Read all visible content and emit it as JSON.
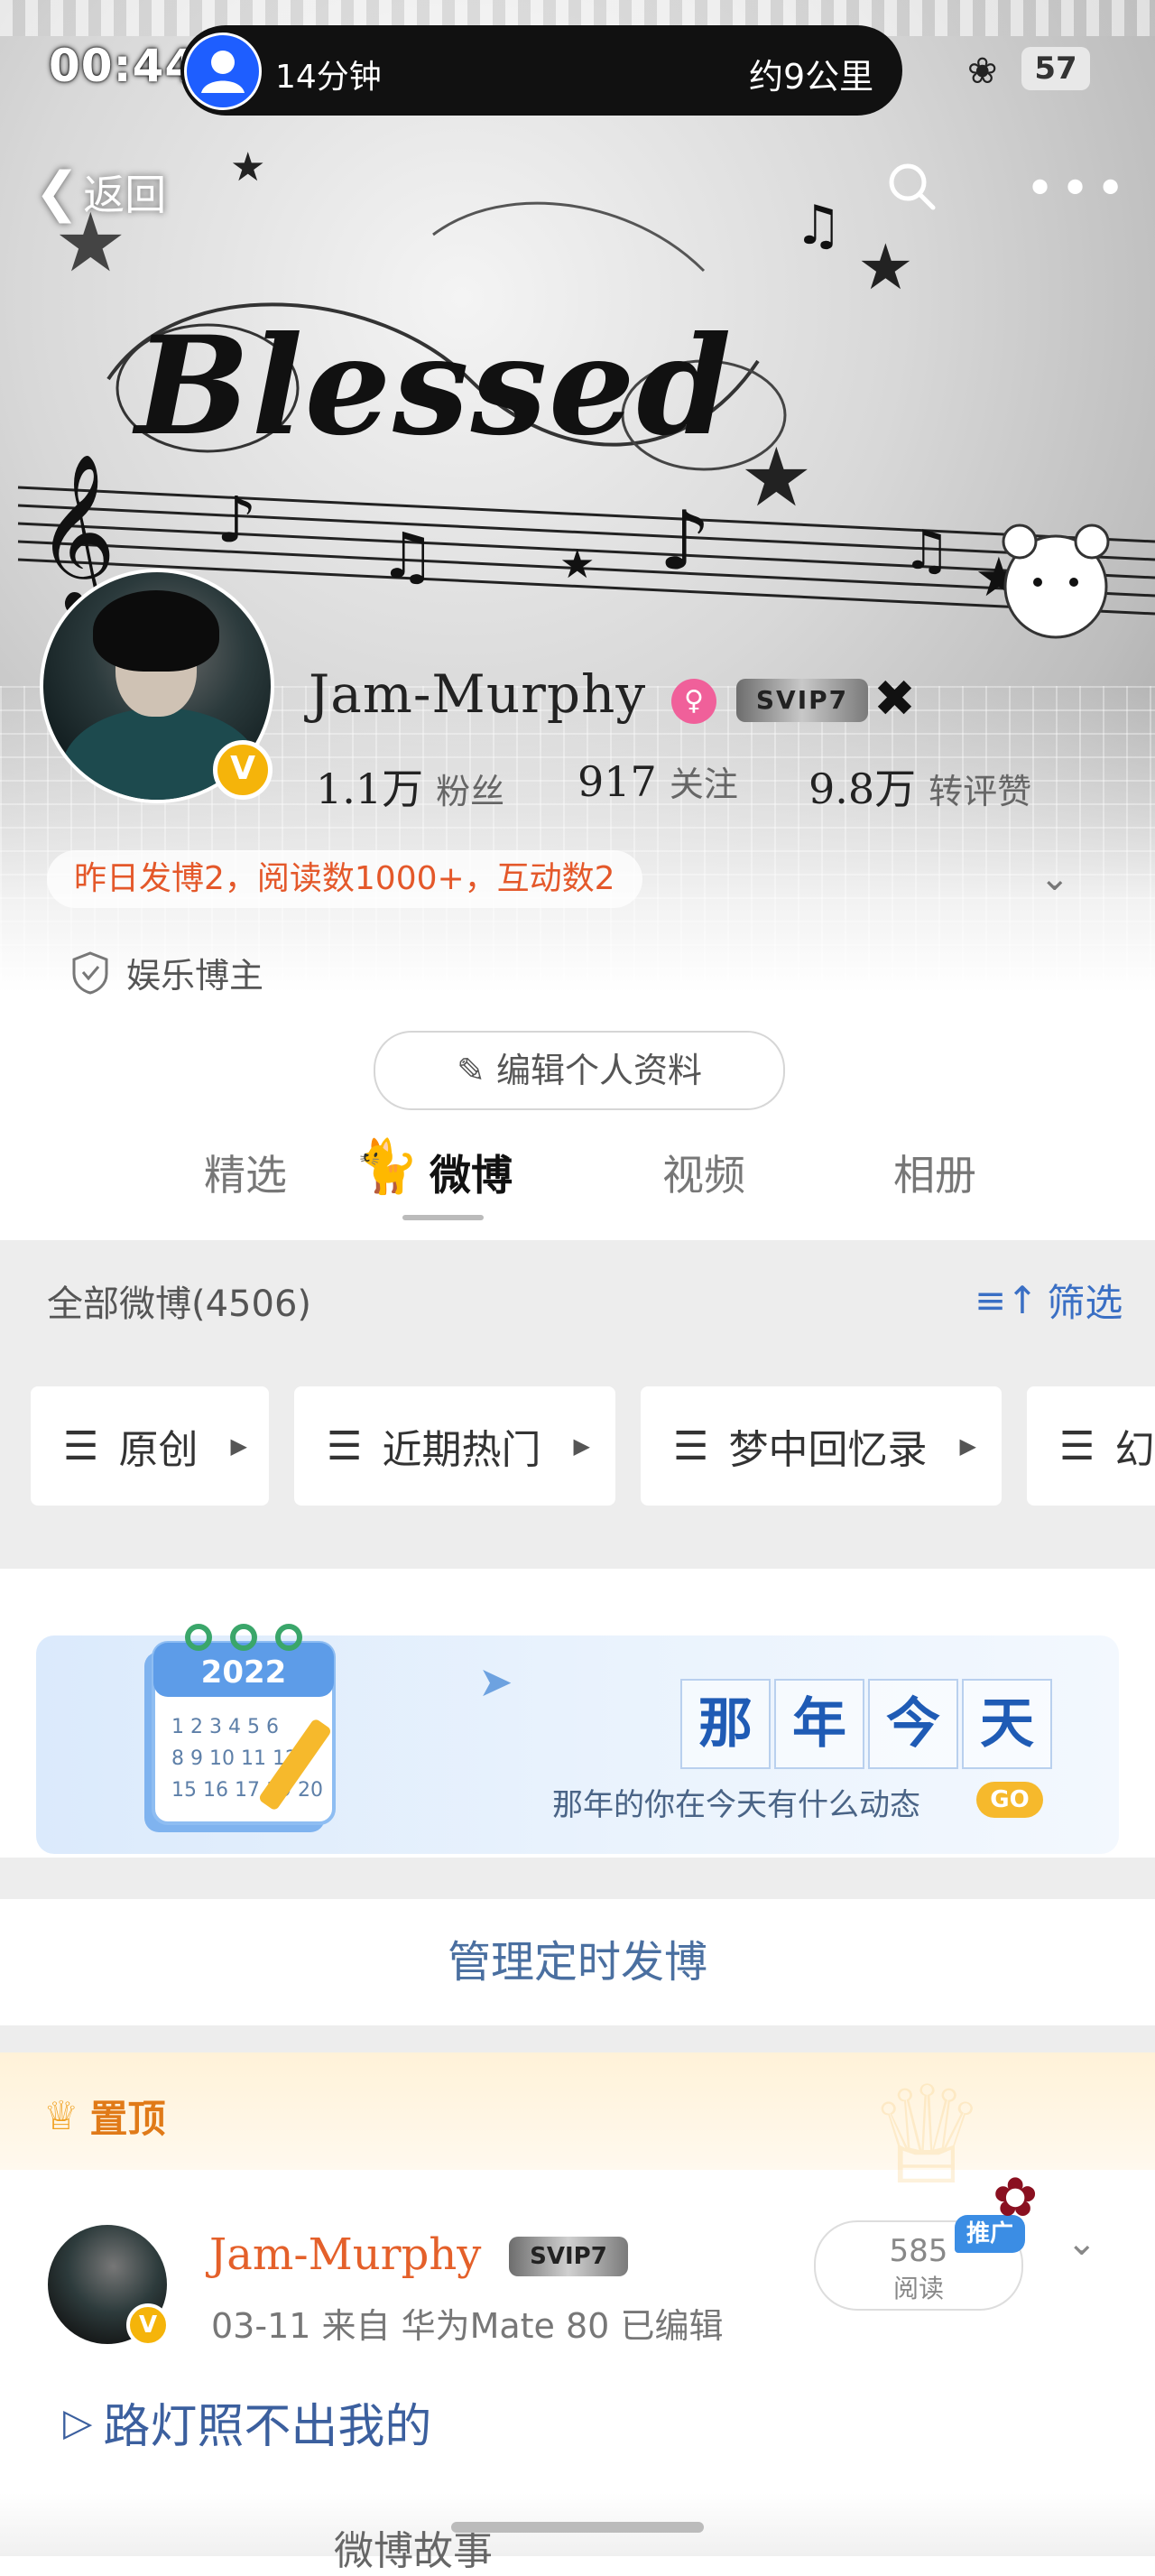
{
  "status_bar": {
    "time": "00:44",
    "nav_eta": "14分钟",
    "nav_distance": "约9公里",
    "battery": "57"
  },
  "header": {
    "back_label": "返回",
    "banner_text": "Blessed"
  },
  "profile": {
    "username": "Jam-Murphy",
    "svip_level": "SVIP7",
    "stats": [
      {
        "value": "1.1万",
        "label": "粉丝"
      },
      {
        "value": "917",
        "label": "关注"
      },
      {
        "value": "9.8万",
        "label": "转评赞"
      }
    ],
    "summary": "昨日发博2，阅读数1000+，互动数2",
    "category": "娱乐博主",
    "edit_label": "编辑个人资料"
  },
  "tabs": [
    {
      "label": "精选"
    },
    {
      "label": "微博"
    },
    {
      "label": "视频"
    },
    {
      "label": "相册"
    }
  ],
  "filter": {
    "all_label": "全部微博(4506)",
    "filter_label": "筛选",
    "chips": [
      "原创",
      "近期热门",
      "梦中回忆录",
      "幻"
    ]
  },
  "on_this_day": {
    "calendar_year": "2022",
    "title": [
      "那",
      "年",
      "今",
      "天"
    ],
    "subtitle": "那年的你在今天有什么动态",
    "go_label": "GO"
  },
  "manage_label": "管理定时发博",
  "pinned": {
    "label": "置顶",
    "user": "Jam-Murphy",
    "svip_level": "SVIP7",
    "meta": "03-11  来自 华为Mate 80  已编辑",
    "read_count": "585",
    "read_label": "阅读",
    "promo_label": "推广",
    "text": "路灯照不出我的"
  },
  "bottom": {
    "partial_text": "微博故事"
  },
  "colors": {
    "accent_blue": "#3a6fc4",
    "orange": "#e4582a",
    "verified": "#f5b40a"
  }
}
